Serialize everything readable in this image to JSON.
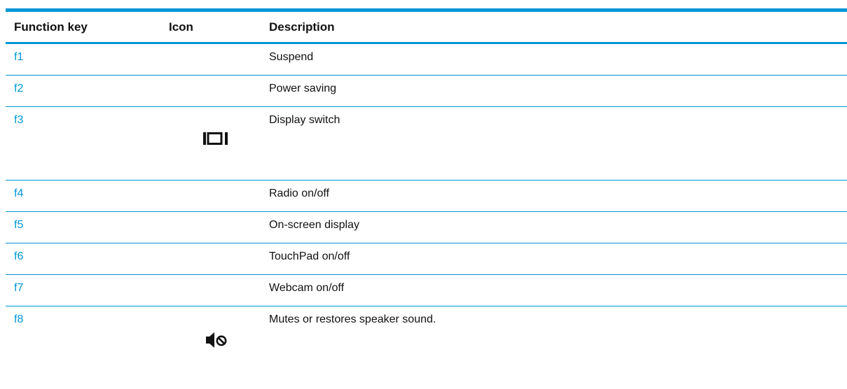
{
  "table": {
    "headers": {
      "function_key": "Function key",
      "icon": "Icon",
      "description": "Description"
    },
    "rows": [
      {
        "key": "f1",
        "icon": "",
        "description": "Suspend"
      },
      {
        "key": "f2",
        "icon": "",
        "description": "Power saving"
      },
      {
        "key": "f3",
        "icon": "display-switch-icon",
        "description": "Display switch"
      },
      {
        "key": "f4",
        "icon": "",
        "description": "Radio on/off"
      },
      {
        "key": "f5",
        "icon": "",
        "description": "On-screen display"
      },
      {
        "key": "f6",
        "icon": "",
        "description": "TouchPad on/off"
      },
      {
        "key": "f7",
        "icon": "",
        "description": "Webcam on/off"
      },
      {
        "key": "f8",
        "icon": "mute-icon",
        "description": "Mutes or restores speaker sound."
      }
    ]
  },
  "colors": {
    "accent": "#0096d6",
    "text": "#111111"
  }
}
